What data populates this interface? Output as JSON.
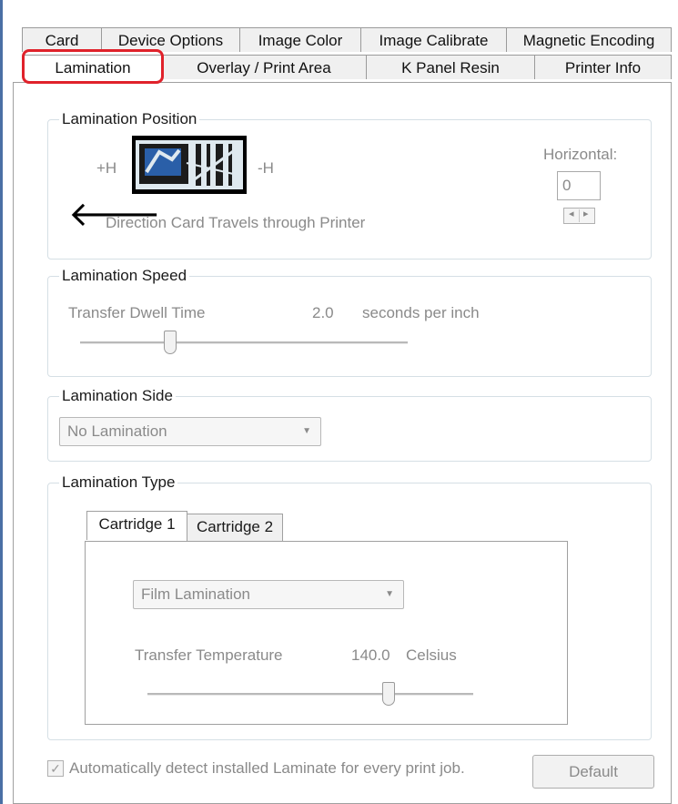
{
  "tabs_row1": [
    "Card",
    "Device Options",
    "Image Color",
    "Image Calibrate",
    "Magnetic Encoding"
  ],
  "tabs_row2": [
    "Lamination",
    "Overlay / Print Area",
    "K Panel Resin",
    "Printer Info"
  ],
  "active_tab": "Lamination",
  "position": {
    "title": "Lamination Position",
    "plus_h": "+H",
    "minus_h": "-H",
    "direction_text": "Direction Card Travels through Printer",
    "horizontal_label": "Horizontal:",
    "horizontal_value": "0",
    "spin_left": "◂",
    "spin_right": "▸",
    "arrow_glyph": "🡐"
  },
  "speed": {
    "title": "Lamination Speed",
    "label": "Transfer Dwell Time",
    "value": "2.0",
    "unit": "seconds per inch"
  },
  "side": {
    "title": "Lamination Side",
    "selected": "No Lamination",
    "arrow": "▼"
  },
  "type": {
    "title": "Lamination Type",
    "tabs": [
      "Cartridge 1",
      "Cartridge 2"
    ],
    "selected": "Film Lamination",
    "arrow": "▼",
    "temp_label": "Transfer Temperature",
    "temp_value": "140.0",
    "temp_unit": "Celsius"
  },
  "auto_detect": {
    "checked": true,
    "check_glyph": "✓",
    "label": "Automatically detect installed Laminate for every print job."
  },
  "default_button": "Default"
}
